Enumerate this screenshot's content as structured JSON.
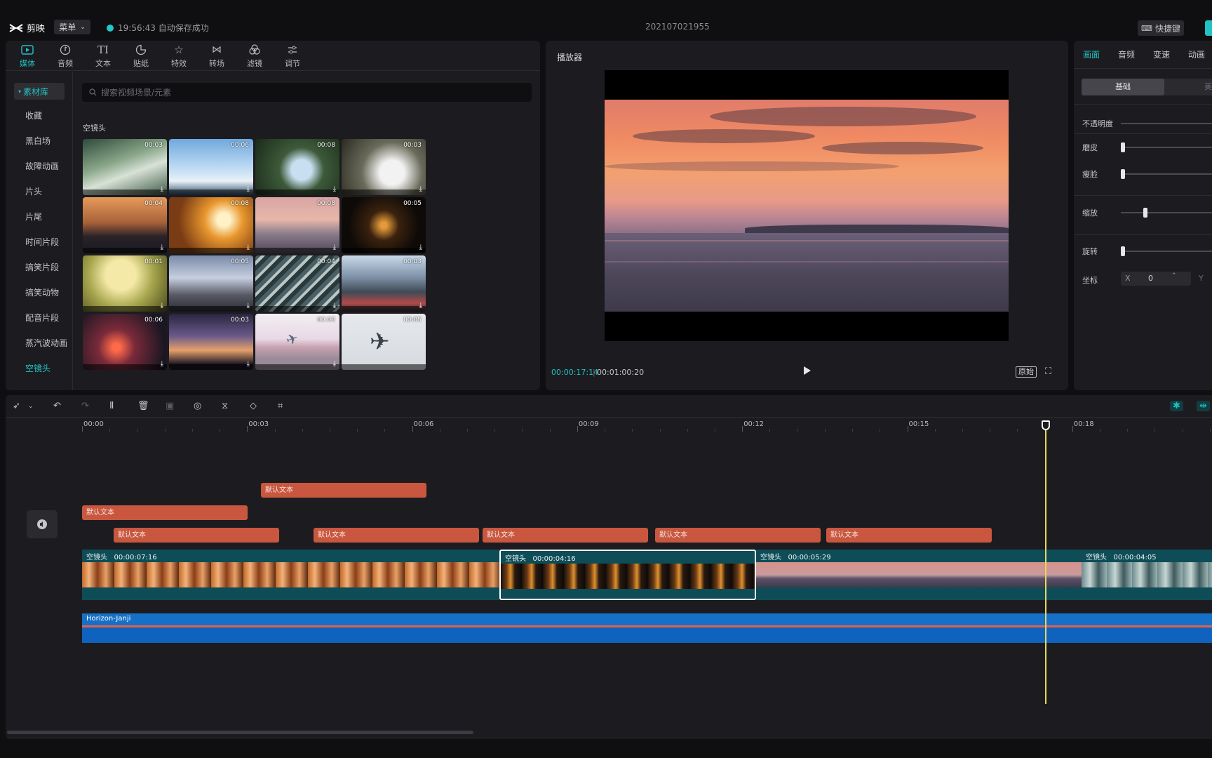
{
  "app": {
    "logo_text": "剪映",
    "menu_label": "菜单",
    "save_status": "19:56:43 自动保存成功",
    "project_title": "202107021955",
    "shortcut_label": "快捷键"
  },
  "media_tabs": [
    {
      "label": "媒体",
      "icon": "media-icon",
      "active": true
    },
    {
      "label": "音频",
      "icon": "audio-icon"
    },
    {
      "label": "文本",
      "icon": "text-icon"
    },
    {
      "label": "贴纸",
      "icon": "sticker-icon"
    },
    {
      "label": "特效",
      "icon": "effects-icon"
    },
    {
      "label": "转场",
      "icon": "transition-icon"
    },
    {
      "label": "滤镜",
      "icon": "filter-icon"
    },
    {
      "label": "调节",
      "icon": "adjust-icon"
    }
  ],
  "sidebar": {
    "library_label": "素材库",
    "items": [
      "收藏",
      "黑白场",
      "故障动画",
      "片头",
      "片尾",
      "时间片段",
      "搞笑片段",
      "搞笑动物",
      "配音片段",
      "蒸汽波动画",
      "空镜头"
    ]
  },
  "search": {
    "placeholder": "搜索视频场景/元素"
  },
  "section_title": "空镜头",
  "thumbnails": [
    {
      "duration": "00:03"
    },
    {
      "duration": "00:06"
    },
    {
      "duration": "00:08"
    },
    {
      "duration": "00:03"
    },
    {
      "duration": "00:04"
    },
    {
      "duration": "00:08"
    },
    {
      "duration": "00:08"
    },
    {
      "duration": "00:05"
    },
    {
      "duration": "00:01"
    },
    {
      "duration": "00:05"
    },
    {
      "duration": "00:04"
    },
    {
      "duration": "00:03"
    },
    {
      "duration": "00:06"
    },
    {
      "duration": "00:03"
    },
    {
      "duration": "00:03"
    },
    {
      "duration": "00:05"
    }
  ],
  "player": {
    "title": "播放器",
    "current_time": "00:00:17:14",
    "separator": "|",
    "total_time": "00:01:00:20",
    "ratio_label": "原始"
  },
  "props": {
    "tabs": [
      "画面",
      "音频",
      "变速",
      "动画"
    ],
    "seg_on": "基础",
    "seg_off": "美颜",
    "opacity_label": "不透明度",
    "smooth_label": "磨皮",
    "thin_face_label": "瘦脸",
    "scale_label": "缩放",
    "rotate_label": "旋转",
    "position_label": "坐标",
    "x_label": "X",
    "x_value": "0",
    "y_label": "Y"
  },
  "timeline": {
    "ruler": [
      "00:00",
      "00:03",
      "00:06",
      "00:09",
      "00:12",
      "00:15",
      "00:18"
    ],
    "text_clip_label": "默认文本",
    "video_clips": [
      {
        "label": "空镜头",
        "duration": "00:00:07:16"
      },
      {
        "label": "空镜头",
        "duration": "00:00:04:16"
      },
      {
        "label": "空镜头",
        "duration": "00:00:05:29"
      },
      {
        "label": "空镜头",
        "duration": "00:00:04:05"
      }
    ],
    "audio_clip": "Horizon-Janji"
  },
  "colors": {
    "accent": "#22c1c3",
    "text_clip": "#c9573f",
    "video_clip": "#0e4d57",
    "audio_clip": "#1670c7",
    "playhead": "#e8d85a"
  }
}
